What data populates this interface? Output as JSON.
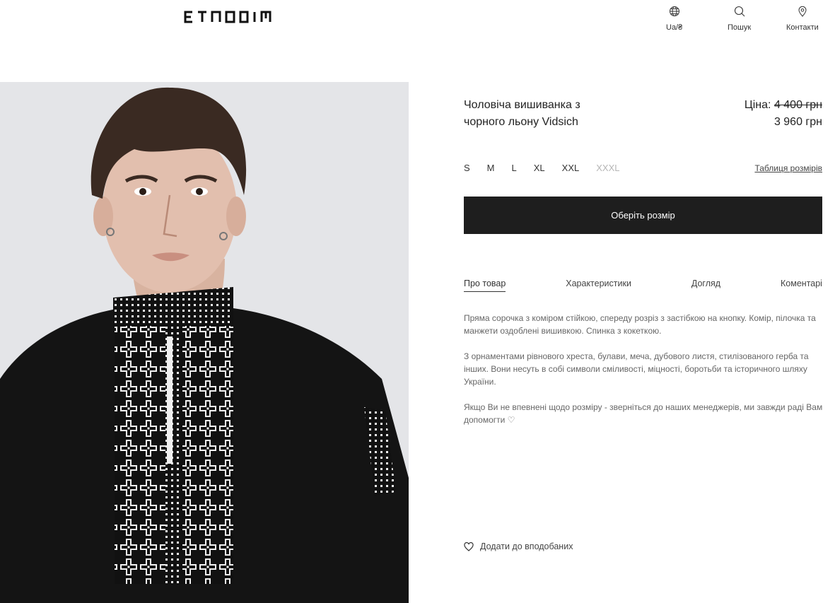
{
  "header": {
    "logo_text": "ETNODIM",
    "nav": [
      {
        "label": "Ua/₴",
        "icon": "globe-icon"
      },
      {
        "label": "Пошук",
        "icon": "search-icon"
      },
      {
        "label": "Контакти",
        "icon": "location-pin-icon"
      }
    ]
  },
  "product": {
    "title_line1": "Чоловіча вишиванка з",
    "title_line2": "чорного льону Vidsich",
    "price_label": "Ціна:",
    "price_old": "4 400 грн",
    "price_new": "3 960 грн",
    "sizes": [
      {
        "label": "S",
        "available": true
      },
      {
        "label": "M",
        "available": true
      },
      {
        "label": "L",
        "available": true
      },
      {
        "label": "XL",
        "available": true
      },
      {
        "label": "XXL",
        "available": true
      },
      {
        "label": "XXXL",
        "available": false
      }
    ],
    "size_table_link": "Таблиця розмірів",
    "cta_label": "Оберіть розмір",
    "tabs": [
      "Про товар",
      "Характеристики",
      "Догляд",
      "Коментарі"
    ],
    "active_tab": "Про товар",
    "description": {
      "p1": "Пряма сорочка з коміром стійкою, спереду розріз з застібкою на кнопку. Комір, пілочка та манжети оздоблені вишивкою. Спинка з кокеткою.",
      "p2": "З орнаментами рівнового хреста, булави, меча, дубового листя, стилізованого герба та інших. Вони несуть в собі символи сміливості, міцності, боротьби та історичного шляху України.",
      "p3": "Якщо Ви не впевнені щодо розміру - зверніться до наших менеджерів, ми завжди раді Вам допомогти ♡"
    },
    "favorite_label": "Додати до вподобаних"
  },
  "colors": {
    "cta_background": "#1e1e1e",
    "disabled_size": "#b5b5b5",
    "description_text": "#666666"
  }
}
